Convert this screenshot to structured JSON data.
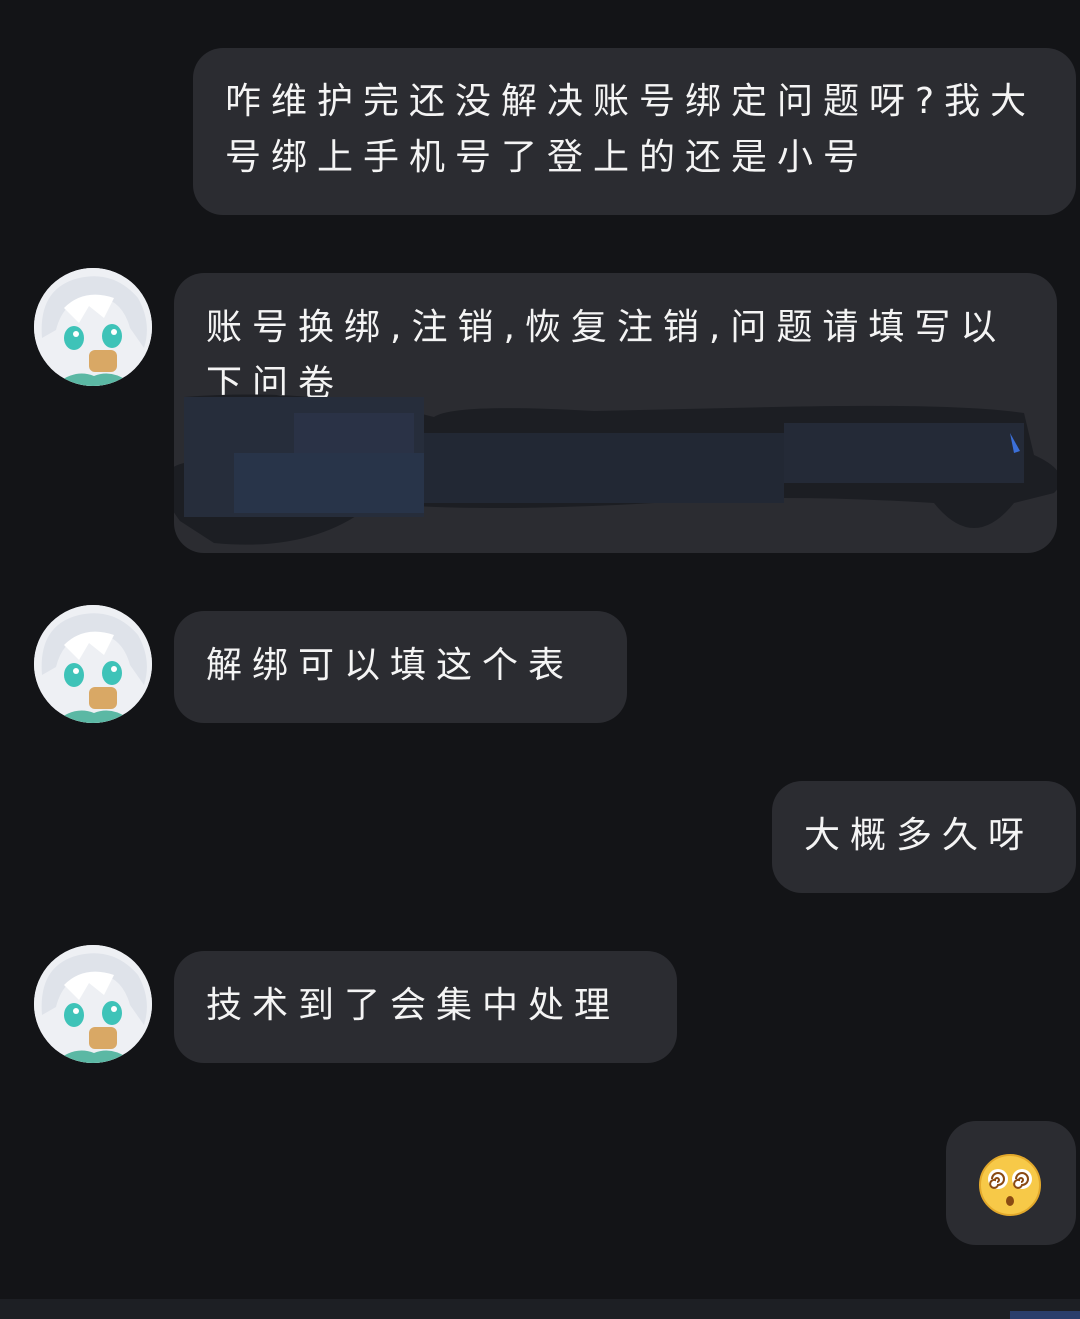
{
  "messages": [
    {
      "side": "right",
      "text": "咋维护完还没解决账号绑定问题呀?我大号绑上手机号了登上的还是小号"
    },
    {
      "side": "left",
      "text": "账号换绑,注销,恢复注销,问题请填写以下问卷"
    },
    {
      "side": "left",
      "text": "解绑可以填这个表"
    },
    {
      "side": "right",
      "text": "大概多久呀"
    },
    {
      "side": "left",
      "text": "技术到了会集中处理"
    },
    {
      "side": "right",
      "emoji": "dizzy-face-emoji"
    }
  ],
  "colors": {
    "background": "#131417",
    "bubble": "#2b2c31",
    "text": "#f4f4f4",
    "redaction": "#283449"
  }
}
